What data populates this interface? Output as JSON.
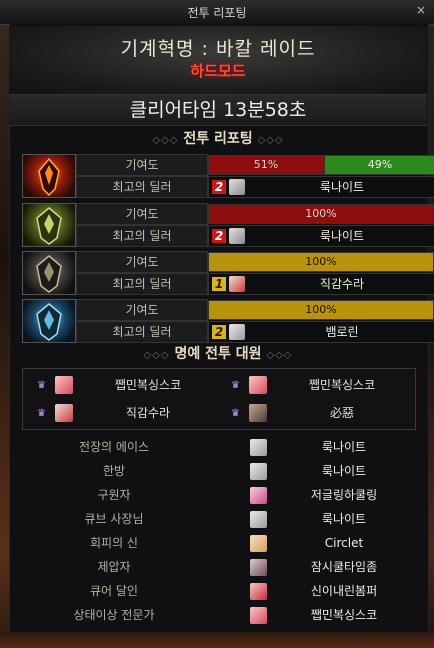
{
  "window": {
    "title": "전투 리포팅",
    "close": "×"
  },
  "header": {
    "title": "기계혁명 : 바칼 레이드",
    "mode": "하드모드"
  },
  "clear_time": "클리어타임 13분58초",
  "report_heading": "전투 리포팅",
  "honor_heading": "명예 전투 대원",
  "section_deco_left": "◇◇◇",
  "section_deco_right": "◇◇◇",
  "colors": {
    "bar_red": "#8e0e0e",
    "bar_green": "#2c8a1c",
    "bar_gold": "#b8920c",
    "rank2": "#c81818",
    "rank1_gold": "#d8b41c"
  },
  "bosses": [
    {
      "icon": "red-dragon-icon",
      "contrib_label": "기여도",
      "dealer_label": "최고의 딜러",
      "bars": [
        {
          "text": "51%",
          "pct": 51,
          "color": "red"
        },
        {
          "text": "49%",
          "pct": 49,
          "color": "green"
        }
      ],
      "rank": "2",
      "dealer": "룩나이트"
    },
    {
      "icon": "green-dragon-icon",
      "contrib_label": "기여도",
      "dealer_label": "최고의 딜러",
      "bars": [
        {
          "text": "100%",
          "pct": 100,
          "color": "red"
        }
      ],
      "rank": "2",
      "dealer": "룩나이트"
    },
    {
      "icon": "black-dragon-icon",
      "contrib_label": "기여도",
      "dealer_label": "최고의 딜러",
      "bars": [
        {
          "text": "100%",
          "pct": 100,
          "color": "gold"
        }
      ],
      "rank": "1",
      "dealer": "직감수라"
    },
    {
      "icon": "blue-dragon-icon",
      "contrib_label": "기여도",
      "dealer_label": "최고의 딜러",
      "bars": [
        {
          "text": "100%",
          "pct": 100,
          "color": "gold"
        }
      ],
      "rank": "2",
      "dealer": "뱀로린"
    }
  ],
  "honor": [
    {
      "name": "쨉민복싱스코"
    },
    {
      "name": "쨉민복싱스코"
    },
    {
      "name": "직감수라"
    },
    {
      "name": "必惡"
    }
  ],
  "awards": [
    {
      "title": "전장의 에이스",
      "player": "룩나이트"
    },
    {
      "title": "한방",
      "player": "룩나이트"
    },
    {
      "title": "구원자",
      "player": "저글링하쿨링"
    },
    {
      "title": "큐브 사장님",
      "player": "룩나이트"
    },
    {
      "title": "회피의 신",
      "player": "Circlet"
    },
    {
      "title": "제압자",
      "player": "잠시쿨타임좀"
    },
    {
      "title": "큐어 달인",
      "player": "신이내린봄퍼"
    },
    {
      "title": "상태이상 전문가",
      "player": "쨉민복싱스코"
    }
  ]
}
